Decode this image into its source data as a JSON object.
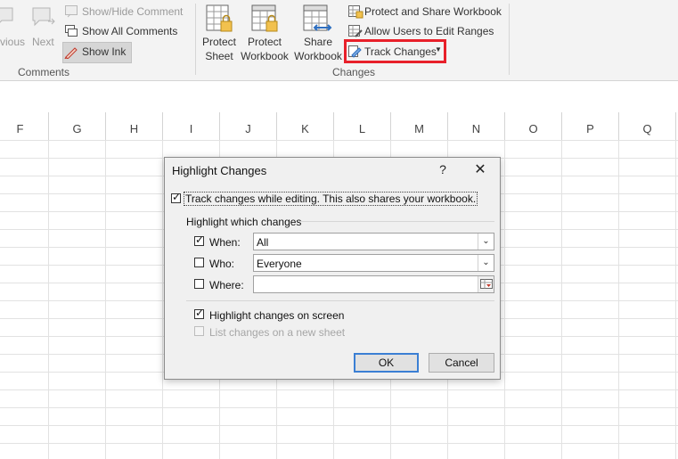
{
  "ribbon": {
    "comments_group": {
      "previous_label": "vious",
      "next_label": "Next",
      "show_hide_comment": "Show/Hide Comment",
      "show_all_comments": "Show All Comments",
      "show_ink": "Show Ink",
      "group_label": "Comments"
    },
    "changes_group": {
      "protect_sheet_line1": "Protect",
      "protect_sheet_line2": "Sheet",
      "protect_workbook_line1": "Protect",
      "protect_workbook_line2": "Workbook",
      "share_workbook_line1": "Share",
      "share_workbook_line2": "Workbook",
      "protect_and_share": "Protect and Share Workbook",
      "allow_users": "Allow Users to Edit Ranges",
      "track_changes": "Track Changes",
      "group_label": "Changes"
    }
  },
  "sheet": {
    "columns": [
      "F",
      "G",
      "H",
      "I",
      "J",
      "K",
      "L",
      "M",
      "N",
      "O",
      "P",
      "Q"
    ]
  },
  "dialog": {
    "title": "Highlight Changes",
    "help": "?",
    "close": "✕",
    "track_changes_checkbox": "Track changes while editing. This also shares your workbook.",
    "highlight_section": "Highlight which changes",
    "when_label": "When:",
    "when_value": "All",
    "who_label": "Who:",
    "who_value": "Everyone",
    "where_label": "Where:",
    "where_value": "",
    "highlight_on_screen": "Highlight changes on screen",
    "list_on_new_sheet": "List changes on a new sheet",
    "ok": "OK",
    "cancel": "Cancel"
  },
  "colors": {
    "highlight_box": "#e8202a",
    "default_button_border": "#3b7fd4"
  }
}
